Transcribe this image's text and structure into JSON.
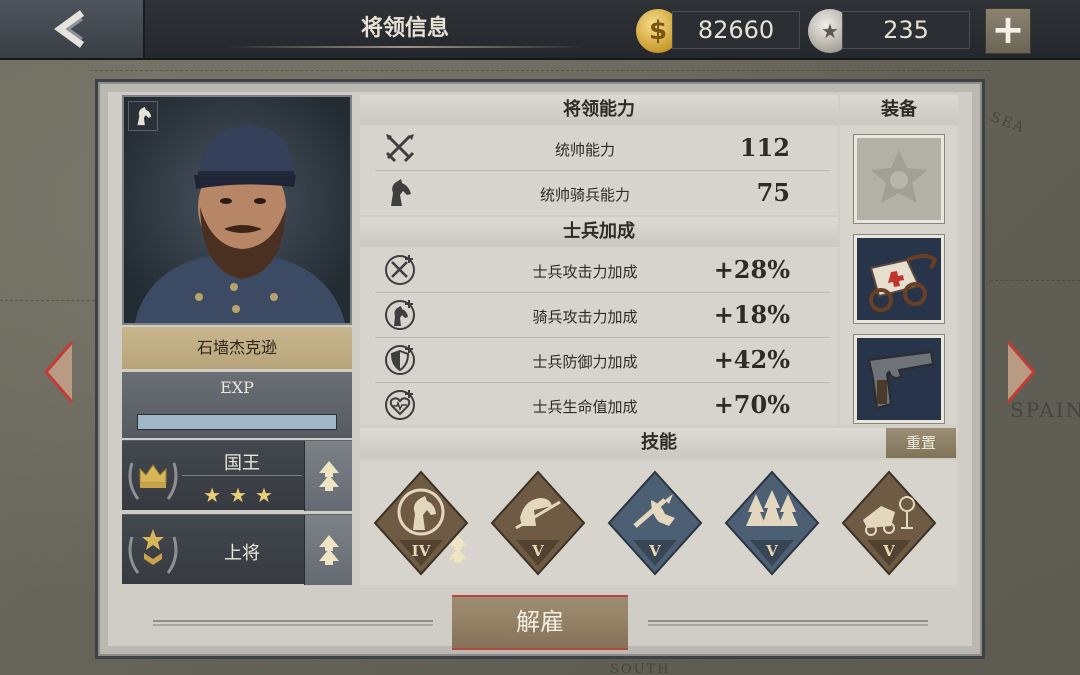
{
  "header": {
    "title": "将领信息",
    "gold": "82660",
    "silver": "235",
    "plus_label": "+"
  },
  "map_labels": {
    "spain": "SPAIN",
    "sea": "SEA",
    "south": "SOUTH"
  },
  "general": {
    "name": "石墙杰克逊",
    "exp_label": "EXP",
    "exp_progress": 1.0,
    "title_rank": "国王",
    "title_stars": 3,
    "military_rank": "上将"
  },
  "abilities": {
    "header": "将领能力",
    "stats": [
      {
        "label": "统帅能力",
        "value": "112",
        "icon": "crossed-swords-icon"
      },
      {
        "label": "统帅骑兵能力",
        "value": "75",
        "icon": "horse-head-icon"
      }
    ]
  },
  "soldier_bonus": {
    "header": "士兵加成",
    "stats": [
      {
        "label": "士兵攻击力加成",
        "value": "+28%",
        "icon": "sword-plus-icon"
      },
      {
        "label": "骑兵攻击力加成",
        "value": "+18%",
        "icon": "horse-plus-icon"
      },
      {
        "label": "士兵防御力加成",
        "value": "+42%",
        "icon": "shield-plus-icon"
      },
      {
        "label": "士兵生命值加成",
        "value": "+70%",
        "icon": "heart-plus-icon"
      }
    ]
  },
  "equipment": {
    "header": "装备",
    "slots": [
      {
        "name": "empty-medal-slot-icon"
      },
      {
        "name": "ambulance-cart-icon"
      },
      {
        "name": "pistol-icon"
      }
    ]
  },
  "skills": {
    "header": "技能",
    "reset_label": "重置",
    "items": [
      {
        "level": "IV",
        "icon": "cavalry-skill-icon",
        "upgradable": true
      },
      {
        "level": "V",
        "icon": "infantry-charge-icon",
        "upgradable": false
      },
      {
        "level": "V",
        "icon": "melee-skill-icon",
        "upgradable": false
      },
      {
        "level": "V",
        "icon": "forest-skill-icon",
        "upgradable": false
      },
      {
        "level": "V",
        "icon": "supply-skill-icon",
        "upgradable": false
      }
    ]
  },
  "actions": {
    "dismiss_label": "解雇"
  },
  "colors": {
    "accent_red": "#b8463f",
    "gold_plate": "#c8b68e",
    "panel_bg": "#cfcdc6",
    "exp_bar": "#9fb7c7"
  }
}
